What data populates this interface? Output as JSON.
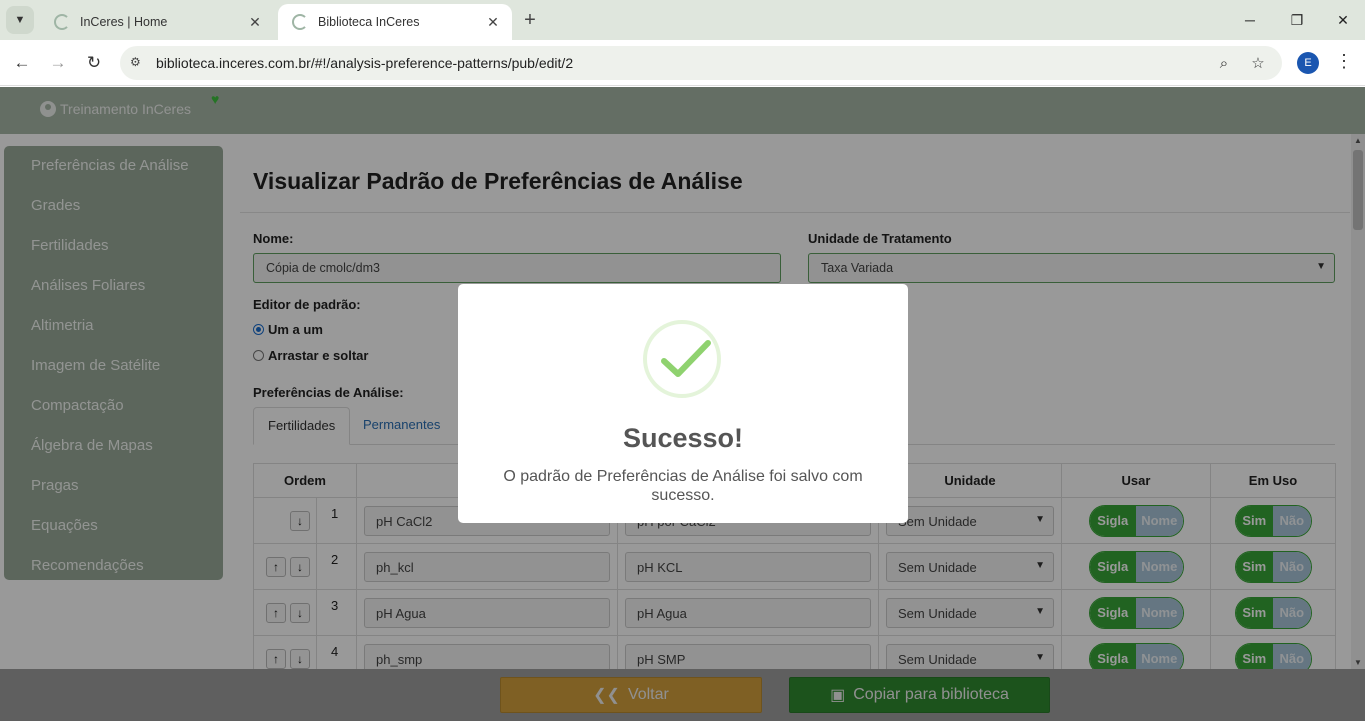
{
  "browser": {
    "tabs": [
      {
        "title": "InCeres | Home",
        "active": false
      },
      {
        "title": "Biblioteca InCeres",
        "active": true
      }
    ],
    "url": "biblioteca.inceres.com.br/#!/analysis-preference-patterns/pub/edit/2",
    "profile_initial": "E"
  },
  "header": {
    "user": "Treinamento InCeres"
  },
  "sidebar": {
    "items": [
      {
        "label": "Preferências de Análise"
      },
      {
        "label": "Grades"
      },
      {
        "label": "Fertilidades"
      },
      {
        "label": "Análises Foliares"
      },
      {
        "label": "Altimetria"
      },
      {
        "label": "Imagem de Satélite"
      },
      {
        "label": "Compactação"
      },
      {
        "label": "Álgebra de Mapas"
      },
      {
        "label": "Pragas"
      },
      {
        "label": "Equações"
      },
      {
        "label": "Recomendações"
      }
    ]
  },
  "main": {
    "title": "Visualizar Padrão de Preferências de Análise",
    "name_label": "Nome:",
    "name_value": "Cópia de cmolc/dm3",
    "unit_label": "Unidade de Tratamento",
    "unit_value": "Taxa Variada",
    "editor_label": "Editor de padrão:",
    "editor_options": [
      {
        "label": "Um a um",
        "selected": true
      },
      {
        "label": "Arrastar e soltar",
        "selected": false
      }
    ],
    "prefs_label": "Preferências de Análise:",
    "tabs": [
      {
        "label": "Fertilidades",
        "active": true
      },
      {
        "label": "Permanentes",
        "active": false
      }
    ],
    "table": {
      "headers": {
        "ordem": "Ordem",
        "sigla": "",
        "nome": "",
        "unidade": "Unidade",
        "usar": "Usar",
        "em_uso": "Em Uso"
      },
      "rows": [
        {
          "num": "1",
          "sigla": "pH CaCl2",
          "nome": "pH por CaCl2",
          "unidade": "Sem Unidade",
          "usar_on": "Sigla",
          "usar_off": "Nome",
          "uso_on": "Sim",
          "uso_off": "Não"
        },
        {
          "num": "2",
          "sigla": "ph_kcl",
          "nome": "pH KCL",
          "unidade": "Sem Unidade",
          "usar_on": "Sigla",
          "usar_off": "Nome",
          "uso_on": "Sim",
          "uso_off": "Não"
        },
        {
          "num": "3",
          "sigla": "pH Agua",
          "nome": "pH Agua",
          "unidade": "Sem Unidade",
          "usar_on": "Sigla",
          "usar_off": "Nome",
          "uso_on": "Sim",
          "uso_off": "Não"
        },
        {
          "num": "4",
          "sigla": "ph_smp",
          "nome": "pH SMP",
          "unidade": "Sem Unidade",
          "usar_on": "Sigla",
          "usar_off": "Nome",
          "uso_on": "Sim",
          "uso_off": "Não"
        }
      ]
    }
  },
  "modal": {
    "title": "Sucesso!",
    "message": "O padrão de Preferências de Análise foi salvo com sucesso."
  },
  "footer": {
    "back_label": "Voltar",
    "copy_label": "Copiar para biblioteca"
  },
  "colors": {
    "accent_green": "#37a537",
    "back_button": "#d4a13d",
    "sidebar": "#9aab9a"
  }
}
